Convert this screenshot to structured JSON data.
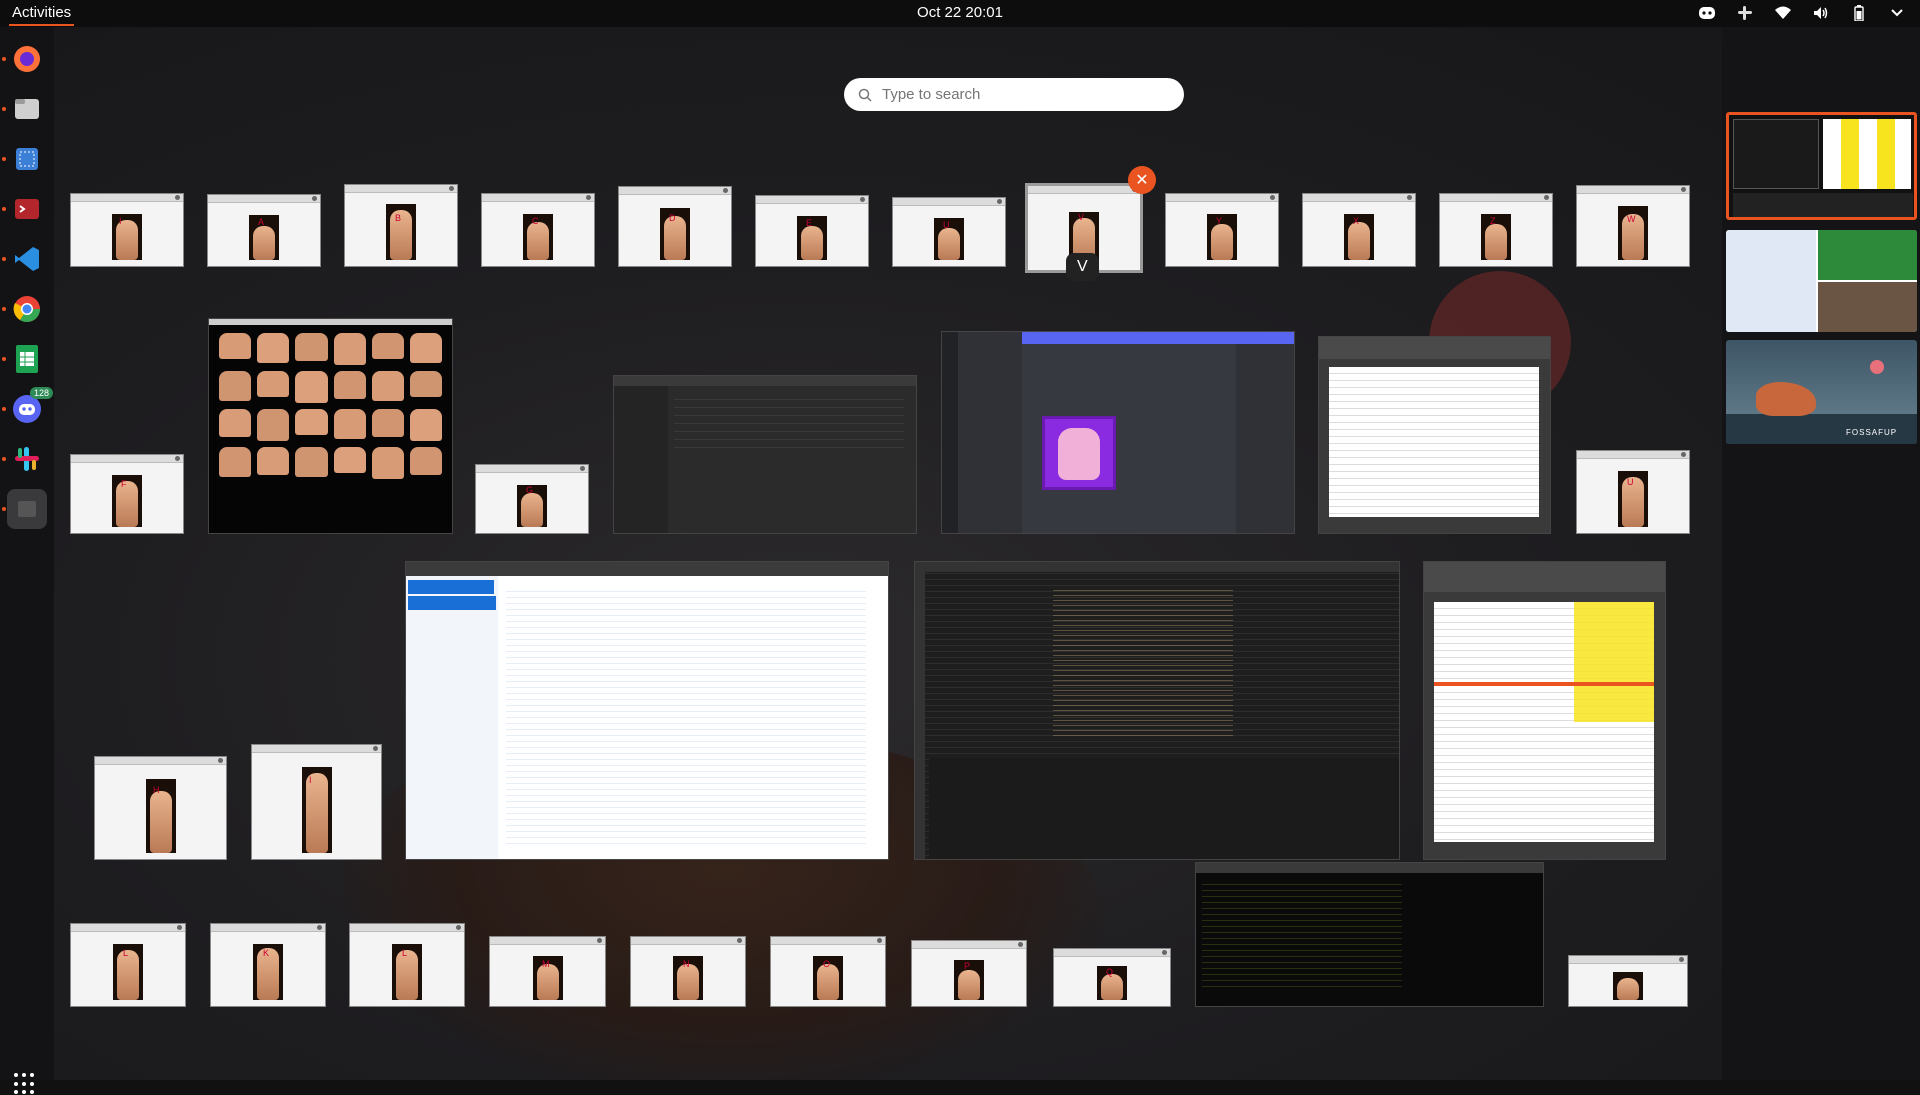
{
  "topbar": {
    "activities_label": "Activities",
    "clock_text": "Oct 22  20:01",
    "tray_icons": [
      "discord-tray-icon",
      "slack-tray-icon",
      "wifi-icon",
      "volume-icon",
      "battery-icon",
      "system-menu-chevron-icon"
    ]
  },
  "search": {
    "placeholder": "Type to search"
  },
  "dock": {
    "items": [
      {
        "name": "firefox",
        "running": true,
        "color": "#ff7139"
      },
      {
        "name": "files",
        "running": true,
        "color": "#c8c8c8"
      },
      {
        "name": "screenshot",
        "running": true,
        "color": "#3b7fd6"
      },
      {
        "name": "gnome-terminal",
        "running": true,
        "color": "#b3262b"
      },
      {
        "name": "vscode",
        "running": true,
        "color": "#2a8fe0"
      },
      {
        "name": "chrome",
        "running": true,
        "color": "#34a853"
      },
      {
        "name": "libreoffice-calc",
        "running": true,
        "color": "#1da352"
      },
      {
        "name": "discord",
        "running": true,
        "color": "#5865f2",
        "badge": "128"
      },
      {
        "name": "slack",
        "running": true,
        "color": "#e01e5a"
      },
      {
        "name": "active-window",
        "running": true,
        "color": "#333333"
      }
    ]
  },
  "overview": {
    "hovered_window_tooltip": "V",
    "row1_letters": [
      "I",
      "A",
      "B",
      "C",
      "D",
      "E",
      "U",
      "V",
      "Y",
      "X",
      "Z",
      "W"
    ],
    "row2_letters": [
      "F",
      "G",
      "U"
    ],
    "row3_letters": [
      "H",
      "I"
    ],
    "row4_letters": [
      "L",
      "K",
      "L",
      "M",
      "N",
      "O",
      "P",
      "Q"
    ],
    "big_windows": [
      {
        "id": "alphabet-chart"
      },
      {
        "id": "files-window"
      },
      {
        "id": "discord-window"
      },
      {
        "id": "calc-window-small"
      },
      {
        "id": "cvzone-browser"
      },
      {
        "id": "vscode-window"
      },
      {
        "id": "calc-window-large"
      },
      {
        "id": "terminal-window"
      }
    ]
  },
  "workspaces": [
    {
      "id": "workspace-1",
      "active": true
    },
    {
      "id": "workspace-2",
      "active": false
    },
    {
      "id": "workspace-3",
      "active": false,
      "caption": "FOSSAFUP"
    }
  ],
  "colors": {
    "accent": "#e95420",
    "topbar": "#0d0d0d",
    "panel": "#141416"
  }
}
